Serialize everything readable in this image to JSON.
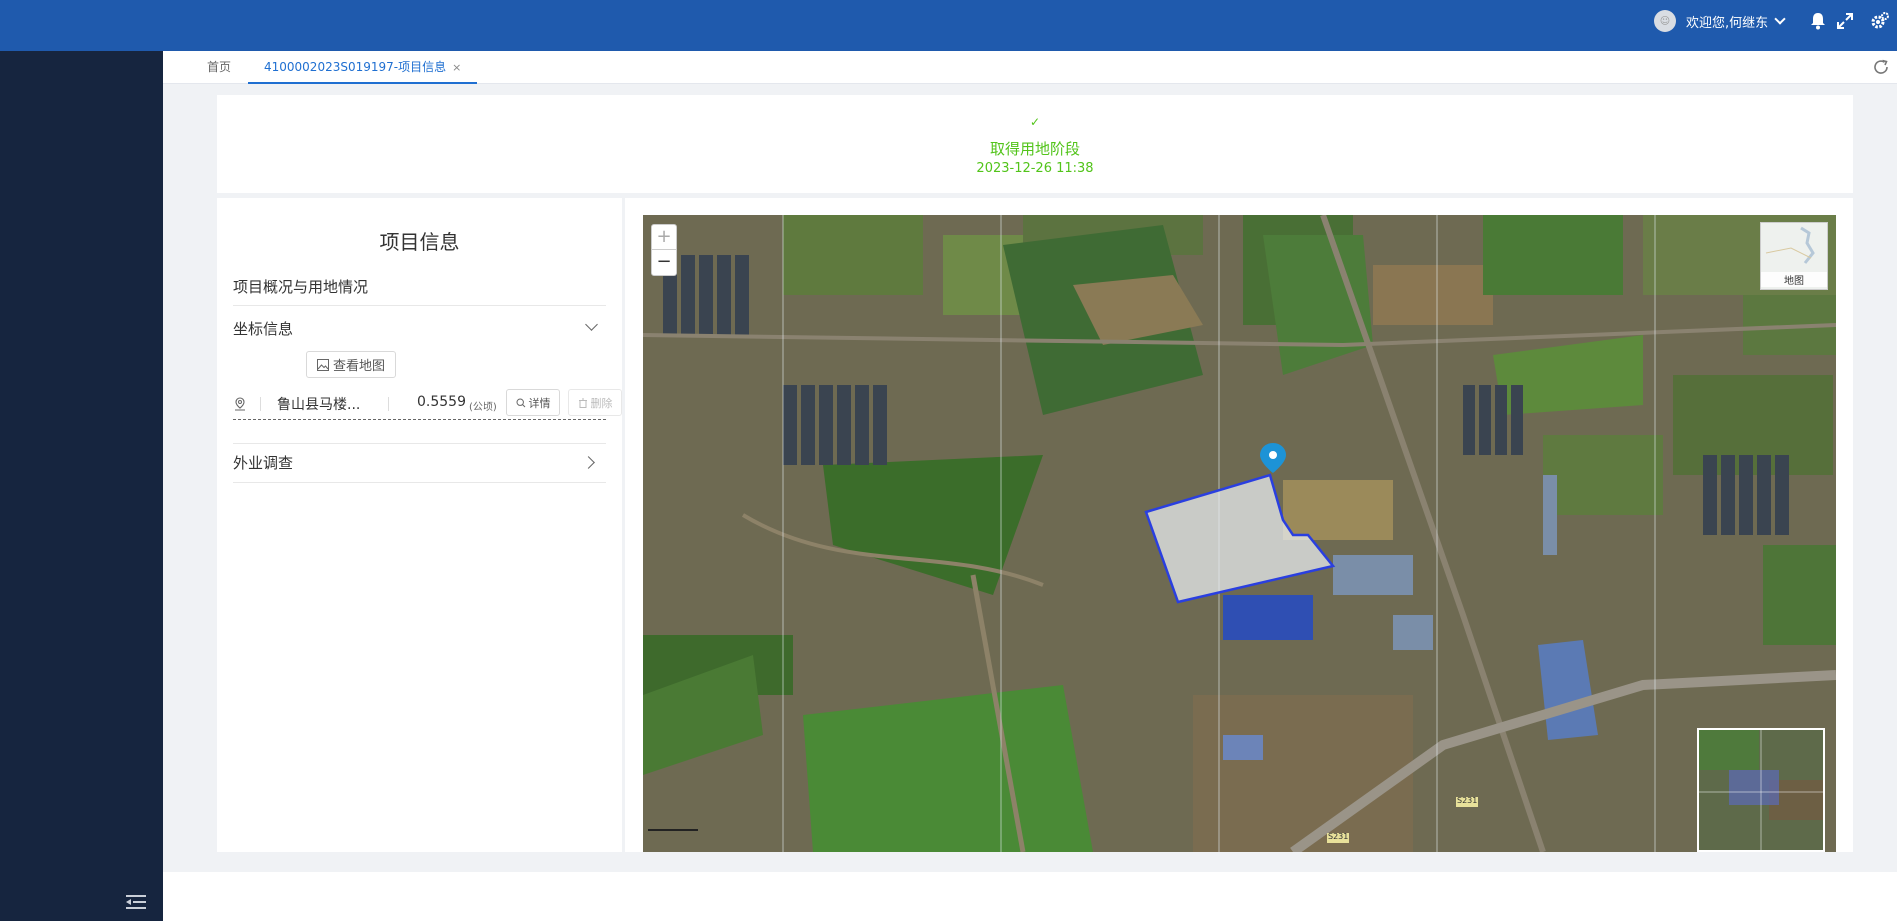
{
  "header": {
    "avatar_text": "☺",
    "welcome_text": "欢迎您,何继东",
    "icons": [
      "bell-icon",
      "fullscreen-icon",
      "settings-icon"
    ]
  },
  "sidebar": {
    "collapse_icon": "menu-collapse-icon"
  },
  "tabs": {
    "home_label": "首页",
    "active_label": "4100002023S019197-项目信息",
    "close_symbol": "×"
  },
  "stage": {
    "check_symbol": "✓",
    "name": "取得用地阶段",
    "time": "2023-12-26 11:38"
  },
  "project": {
    "title": "项目信息",
    "section_overview": "项目概况与用地情况",
    "section_coords": "坐标信息",
    "view_map_label": "查看地图",
    "coords": [
      {
        "location": "鲁山县马楼...",
        "area": "0.5559",
        "unit": "(公顷)",
        "detail_label": "详情",
        "delete_label": "删除"
      }
    ],
    "section_survey": "外业调查"
  },
  "map": {
    "zoom_in": "+",
    "zoom_out": "−",
    "basemap_label": "地图",
    "road_labels": [
      "S231",
      "S231"
    ]
  },
  "colors": {
    "header": "#1f5aad",
    "sidebar": "#16253f",
    "accent": "#1f6fd1",
    "stage_green": "#52c41a",
    "parcel_outline": "#2a3fe0"
  }
}
